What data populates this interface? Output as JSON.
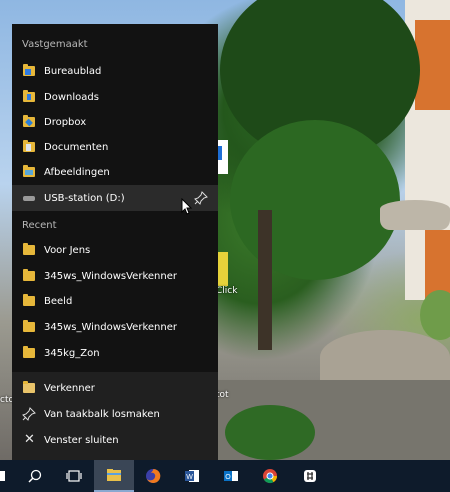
{
  "jumplist": {
    "pinned_header": "Vastgemaakt",
    "pinned": [
      {
        "label": "Bureaublad",
        "icon": "desktop-folder-icon"
      },
      {
        "label": "Downloads",
        "icon": "downloads-folder-icon"
      },
      {
        "label": "Dropbox",
        "icon": "dropbox-folder-icon"
      },
      {
        "label": "Documenten",
        "icon": "documents-folder-icon"
      },
      {
        "label": "Afbeeldingen",
        "icon": "pictures-folder-icon"
      },
      {
        "label": "USB-station (D:)",
        "icon": "usb-drive-icon"
      }
    ],
    "recent_header": "Recent",
    "recent": [
      {
        "label": "Voor Jens",
        "icon": "folder-icon"
      },
      {
        "label": "345ws_WindowsVerkenner",
        "icon": "folder-icon"
      },
      {
        "label": "Beeld",
        "icon": "folder-icon"
      },
      {
        "label": "345ws_WindowsVerkenner",
        "icon": "folder-icon"
      },
      {
        "label": "345kg_Zon",
        "icon": "folder-icon"
      }
    ],
    "actions": [
      {
        "label": "Verkenner",
        "icon": "file-explorer-icon"
      },
      {
        "label": "Van taakbalk losmaken",
        "icon": "unpin-icon"
      },
      {
        "label": "Venster sluiten",
        "icon": "close-icon"
      }
    ]
  },
  "taskbar": {
    "buttons": [
      {
        "name": "start-button",
        "icon": "windows-icon"
      },
      {
        "name": "search-button",
        "icon": "search-icon"
      },
      {
        "name": "task-view-button",
        "icon": "task-view-icon"
      },
      {
        "name": "file-explorer-button",
        "icon": "file-explorer-icon",
        "active": true
      },
      {
        "name": "firefox-button",
        "icon": "firefox-icon"
      },
      {
        "name": "word-button",
        "icon": "word-icon"
      },
      {
        "name": "outlook-button",
        "icon": "outlook-icon"
      },
      {
        "name": "chrome-button",
        "icon": "chrome-icon"
      },
      {
        "name": "slack-button",
        "icon": "slack-icon"
      }
    ]
  },
  "desktop_peek": {
    "label_a": "ctop",
    "label_b": "Click",
    "label_c": "tot"
  }
}
